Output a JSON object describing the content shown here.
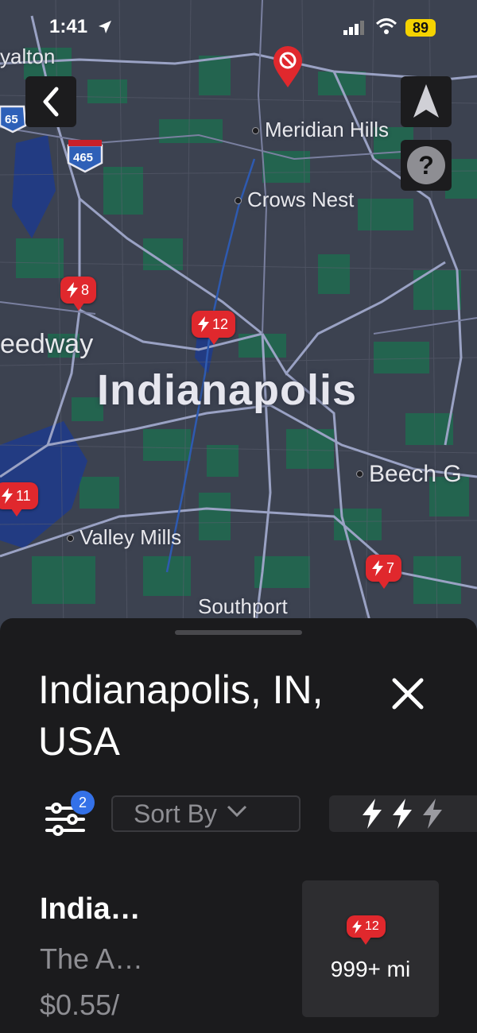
{
  "status": {
    "time": "1:41",
    "battery": "89"
  },
  "map": {
    "places": [
      "yalton",
      "Meridian Hills",
      "Crows Nest",
      "eedway",
      "Beech G",
      "Valley Mills",
      "Southport"
    ],
    "city": "Indianapolis",
    "highways": [
      "65",
      "465"
    ],
    "pins": [
      {
        "count": "8"
      },
      {
        "count": "12"
      },
      {
        "count": "11"
      },
      {
        "count": "7"
      }
    ]
  },
  "sheet": {
    "title": "Indianapolis, IN, USA",
    "filter_count": "2",
    "sort_label": "Sort By",
    "result": {
      "name": "India…",
      "address": "The A…",
      "price": "$0.55/",
      "pin_count": "12",
      "distance": "999+ mi"
    }
  },
  "colors": {
    "pin": "#e0282d",
    "accent": "#3471e8",
    "map_bg": "#3c4250"
  }
}
